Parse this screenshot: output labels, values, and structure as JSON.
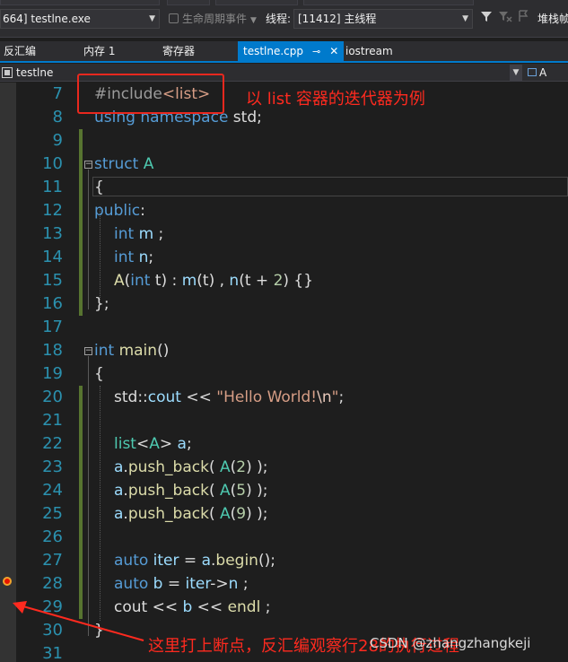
{
  "toolbar": {
    "process": "664] testlne.exe",
    "lifecycle": "生命周期事件",
    "thread_label": "线程:",
    "thread_value": "[11412] 主线程",
    "stack_frame": "堆栈帧"
  },
  "tabs": [
    {
      "label": "反汇编"
    },
    {
      "label": "内存 1"
    },
    {
      "label": "寄存器"
    },
    {
      "label": "testlne.cpp",
      "active": true,
      "pin": "⊸",
      "close": "✕"
    },
    {
      "label": "iostream"
    }
  ],
  "nav": {
    "file": "testlne",
    "member": "A"
  },
  "code_lines": [
    {
      "n": "7"
    },
    {
      "n": "8"
    },
    {
      "n": "9"
    },
    {
      "n": "10"
    },
    {
      "n": "11"
    },
    {
      "n": "12"
    },
    {
      "n": "13"
    },
    {
      "n": "14"
    },
    {
      "n": "15"
    },
    {
      "n": "16"
    },
    {
      "n": "17"
    },
    {
      "n": "18"
    },
    {
      "n": "19"
    },
    {
      "n": "20"
    },
    {
      "n": "21"
    },
    {
      "n": "22"
    },
    {
      "n": "23"
    },
    {
      "n": "24"
    },
    {
      "n": "25"
    },
    {
      "n": "26"
    },
    {
      "n": "27"
    },
    {
      "n": "28"
    },
    {
      "n": "29"
    },
    {
      "n": "30"
    },
    {
      "n": "31"
    }
  ],
  "annotations": {
    "top": "以 list 容器的迭代器为例",
    "bottom": "这里打上断点，反汇编观察行28的执行过程"
  },
  "watermark": "CSDN @zhangzhangkeji",
  "colors": {
    "keyword": "#569cd6",
    "type": "#4ec9b0",
    "string": "#d69d85",
    "number": "#b5cea8",
    "line_number": "#2b91af",
    "annotation": "#ff2a1f",
    "accent": "#007acc"
  }
}
